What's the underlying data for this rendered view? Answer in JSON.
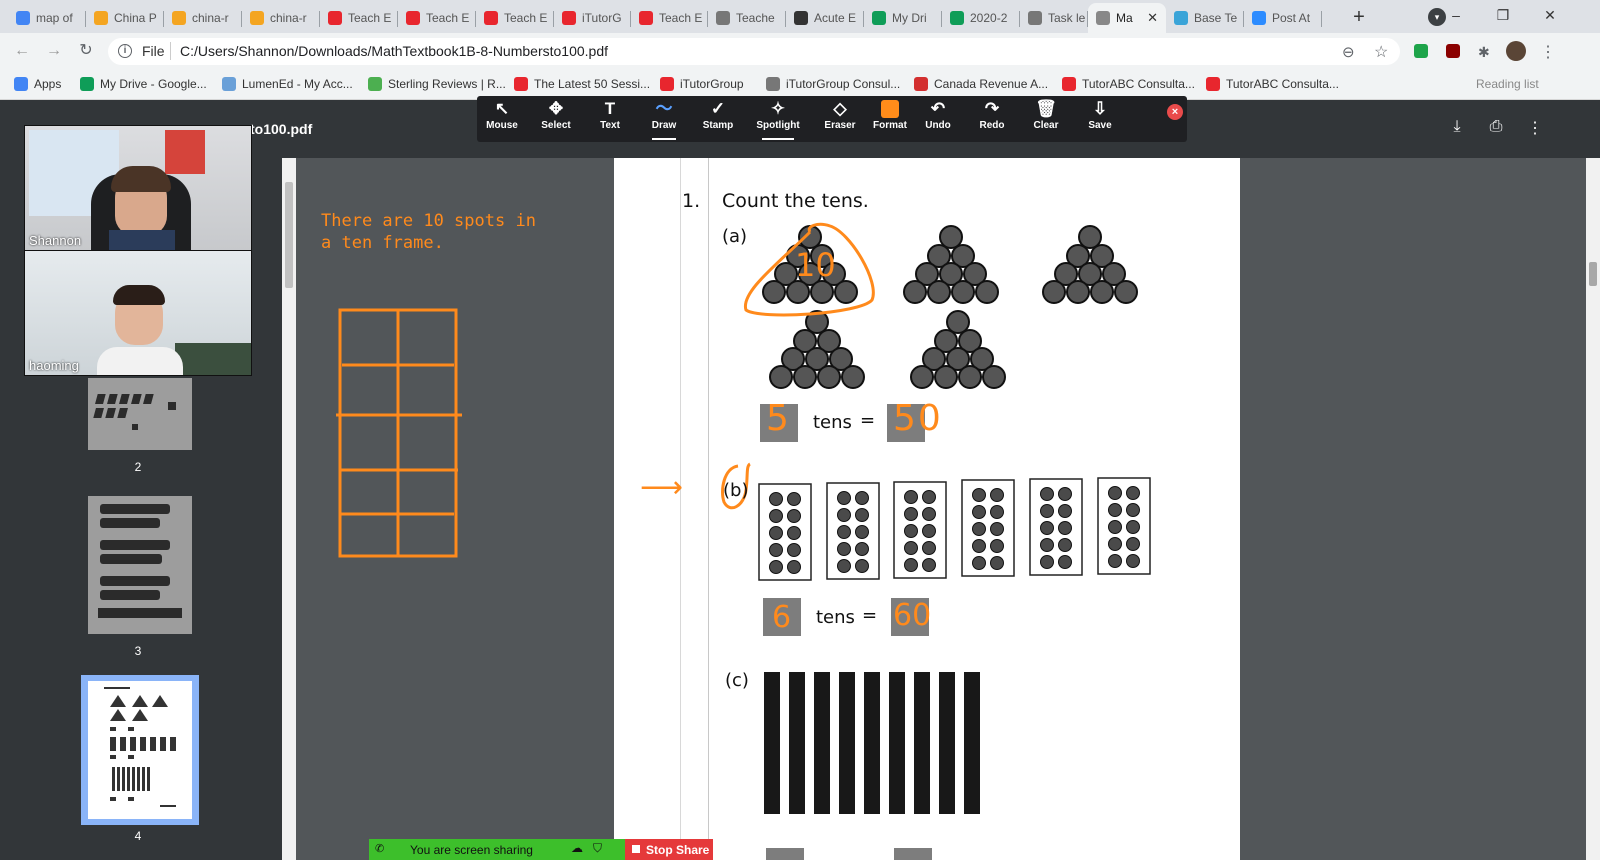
{
  "tabs": [
    {
      "label": "map of",
      "color": "#4285f4"
    },
    {
      "label": "China P",
      "color": "#f4a521"
    },
    {
      "label": "china-r",
      "color": "#f4a521"
    },
    {
      "label": "china-r",
      "color": "#f4a521"
    },
    {
      "label": "Teach E",
      "color": "#e8262e"
    },
    {
      "label": "Teach E",
      "color": "#e8262e"
    },
    {
      "label": "Teach E",
      "color": "#e8262e"
    },
    {
      "label": "iTutorG",
      "color": "#e8262e"
    },
    {
      "label": "Teach E",
      "color": "#e8262e"
    },
    {
      "label": "Teache",
      "color": "#777777"
    },
    {
      "label": "Acute E",
      "color": "#333333"
    },
    {
      "label": "My Dri",
      "color": "#0f9d58"
    },
    {
      "label": "2020-2",
      "color": "#0f9d58"
    },
    {
      "label": "Task le",
      "color": "#777777"
    },
    {
      "label": "Ma",
      "color": "#888888"
    },
    {
      "label": "Base Te",
      "color": "#3aa4d8"
    },
    {
      "label": "Post At",
      "color": "#2d8cff"
    }
  ],
  "address": {
    "scheme": "File",
    "url": "C:/Users/Shannon/Downloads/MathTextbook1B-8-Numbersto100.pdf"
  },
  "bookmarks": [
    {
      "label": "Apps",
      "color": "#4285f4"
    },
    {
      "label": "My Drive - Google...",
      "color": "#0f9d58"
    },
    {
      "label": "LumenEd - My Acc...",
      "color": "#6aa0d8"
    },
    {
      "label": "Sterling Reviews | R...",
      "color": "#4caf50"
    },
    {
      "label": "The Latest 50 Sessi...",
      "color": "#e8262e"
    },
    {
      "label": "iTutorGroup",
      "color": "#e8262e"
    },
    {
      "label": "iTutorGroup Consul...",
      "color": "#777777"
    },
    {
      "label": "Canada Revenue A...",
      "color": "#d32f2f"
    },
    {
      "label": "TutorABC Consulta...",
      "color": "#e8262e"
    },
    {
      "label": "TutorABC Consulta...",
      "color": "#e8262e"
    }
  ],
  "reading_list": "Reading list",
  "pdf": {
    "title": "to100.pdf"
  },
  "annotate_tools": [
    {
      "label": "Mouse",
      "icon": "↖"
    },
    {
      "label": "Select",
      "icon": "✥"
    },
    {
      "label": "Text",
      "icon": "T"
    },
    {
      "label": "Draw",
      "icon": "〜"
    },
    {
      "label": "Stamp",
      "icon": "✓"
    },
    {
      "label": "Spotlight",
      "icon": "✧"
    },
    {
      "label": "Eraser",
      "icon": "◇"
    },
    {
      "label": "Format",
      "icon": ""
    },
    {
      "label": "Undo",
      "icon": "↶"
    },
    {
      "label": "Redo",
      "icon": "↷"
    },
    {
      "label": "Clear",
      "icon": "🗑"
    },
    {
      "label": "Save",
      "icon": "⇩"
    }
  ],
  "videos": [
    {
      "name": "Shannon"
    },
    {
      "name": "haoming"
    }
  ],
  "thumbnails": [
    {
      "num": "2"
    },
    {
      "num": "3"
    },
    {
      "num": "4"
    }
  ],
  "whiteboard_text": "There are 10 spots in a ten frame.",
  "page": {
    "q_num": "1.",
    "q_text": "Count the tens.",
    "a_label": "(a)",
    "b_label": "(b)",
    "c_label": "(c)",
    "tens_word": "tens",
    "equals": "=",
    "a_tens": "5",
    "a_total": "50",
    "b_tens": "6",
    "b_total": "60",
    "circled_num": "10"
  },
  "share": {
    "status": "You are screen sharing",
    "stop": "Stop Share"
  }
}
